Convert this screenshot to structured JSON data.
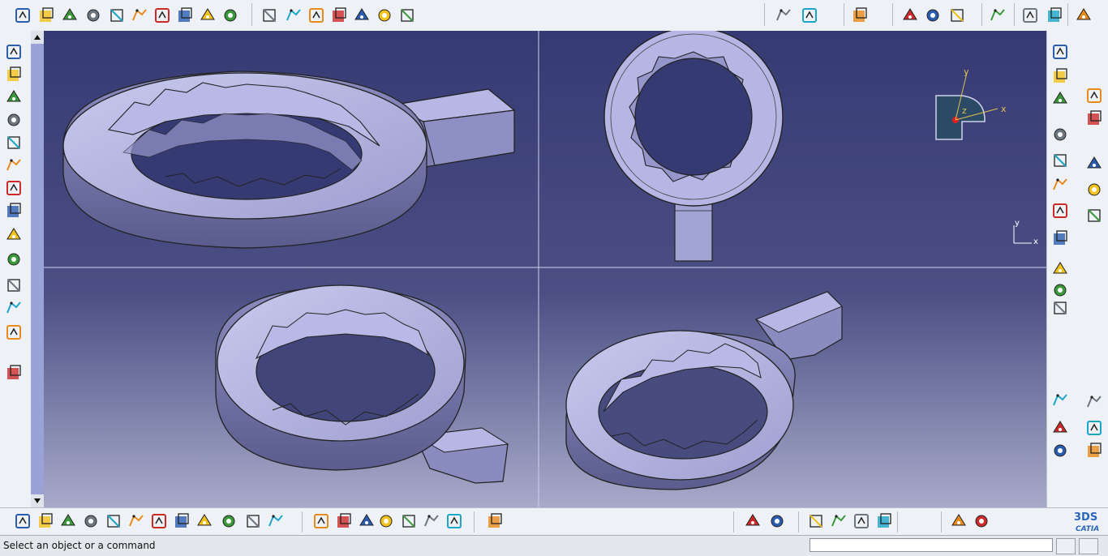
{
  "app": {
    "name": "CATIA",
    "brand": "3DS",
    "accent": "#2a66b8"
  },
  "status_bar": {
    "message": "Select an object or a command",
    "command_input": {
      "value": "",
      "placeholder": ""
    }
  },
  "viewport": {
    "background": "#363a73",
    "layout": "2x2",
    "views": [
      {
        "name": "isometric-view"
      },
      {
        "name": "top-view",
        "compass_labels": [
          "y",
          "z",
          "x"
        ]
      },
      {
        "name": "front-iso-view"
      },
      {
        "name": "back-iso-view"
      }
    ],
    "axis_triad": {
      "y": "y",
      "x": "x"
    }
  },
  "top_toolbar": {
    "icons": [
      "sketch-icon",
      "positioned-sketch-icon",
      "pad-icon",
      "pocket-icon",
      "shaft-icon",
      "groove-icon",
      "hole-icon",
      "rib-icon",
      "slot-icon",
      "stiffener-icon",
      "multi-section-solid-icon",
      "removed-multi-section-icon",
      "draft-icon",
      "chamfer-icon",
      "shell-icon",
      "thickness-icon",
      "thread-icon",
      "translate-icon",
      "mirror-icon",
      "pattern-icon",
      "scale-icon",
      "point-icon",
      "line-icon",
      "plane-icon",
      "axis-system-icon",
      "constraint-icon",
      "grid-icon",
      "compass-icon"
    ]
  },
  "left_toolbar": {
    "icons": [
      "new-icon",
      "open-icon",
      "save-icon",
      "print-icon",
      "cut-icon",
      "copy-icon",
      "paste-icon",
      "undo-icon",
      "redo-icon",
      "whats-this-icon",
      "measure-icon",
      "measure-inertia-icon",
      "apply-material-icon",
      "capture-icon"
    ]
  },
  "right_toolbar": {
    "icons": [
      "part-body-icon",
      "sketcher-icon",
      "publication-icon",
      "boolean-icon",
      "insert-body-icon",
      "transform-icon",
      "mirror-icon",
      "join-icon",
      "dress-up-icon",
      "surface-icon",
      "analysis-icon",
      "tools-icon",
      "pcs-icon",
      "select-icon",
      "text-icon",
      "flag-note-icon",
      "annotation-icon",
      "material-icon",
      "render-icon",
      "shading-icon",
      "view-mode-icon",
      "hide-show-icon"
    ]
  },
  "bottom_toolbar": {
    "icons": [
      "fly-mode-icon",
      "fit-all-icon",
      "pan-icon",
      "rotate-icon",
      "zoom-in-icon",
      "zoom-out-icon",
      "normal-view-icon",
      "multi-view-icon",
      "iso-view-icon",
      "shading-icon",
      "hide-show-icon",
      "swap-visible-icon",
      "formula-icon",
      "comment-icon",
      "knowledge-icon",
      "table-icon",
      "parameters-icon",
      "lock-icon",
      "check-icon",
      "catalog-icon",
      "macro-icon",
      "tree-icon",
      "analysis-icon",
      "render-icon",
      "material-icon",
      "sketch-analysis-icon",
      "apply-icon",
      "update-icon"
    ]
  }
}
